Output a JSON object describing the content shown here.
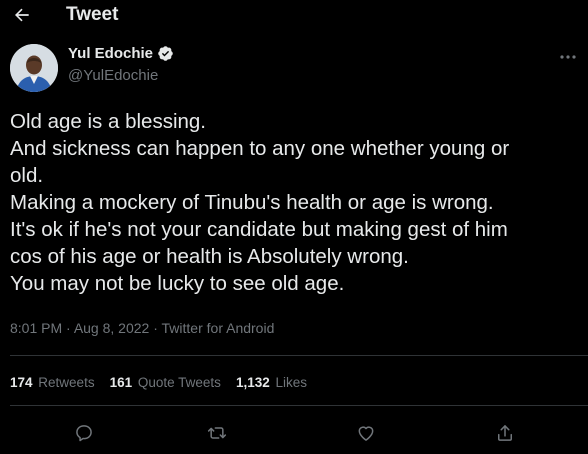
{
  "header": {
    "title": "Tweet",
    "back_icon": "arrow-left-icon"
  },
  "author": {
    "name": "Yul Edochie",
    "handle": "@YulEdochie",
    "verified": true,
    "verified_icon": "verified-badge-icon",
    "more_icon": "more-horizontal-icon"
  },
  "tweet": {
    "lines": [
      "Old age is a blessing.",
      "And sickness can happen to any one whether young or",
      "old.",
      "Making a mockery of Tinubu's health or age is wrong.",
      "It's ok if he's not your candidate but making gest of him",
      "cos of his age or health is Absolutely wrong.",
      "You may not be lucky to see old age."
    ]
  },
  "meta": {
    "time": "8:01 PM",
    "sep1": " · ",
    "date": "Aug 8, 2022",
    "sep2": " · ",
    "source": "Twitter for Android"
  },
  "stats": {
    "retweets_count": "174",
    "retweets_label": "Retweets",
    "quotes_count": "161",
    "quotes_label": "Quote Tweets",
    "likes_count": "1,132",
    "likes_label": "Likes"
  },
  "actions": {
    "reply_icon": "reply-icon",
    "retweet_icon": "retweet-icon",
    "like_icon": "heart-icon",
    "share_icon": "share-icon"
  },
  "colors": {
    "background": "#000000",
    "text_primary": "#e7e9ea",
    "text_secondary": "#71767b",
    "divider": "#2f3336",
    "verified": "#1d9bf0"
  }
}
